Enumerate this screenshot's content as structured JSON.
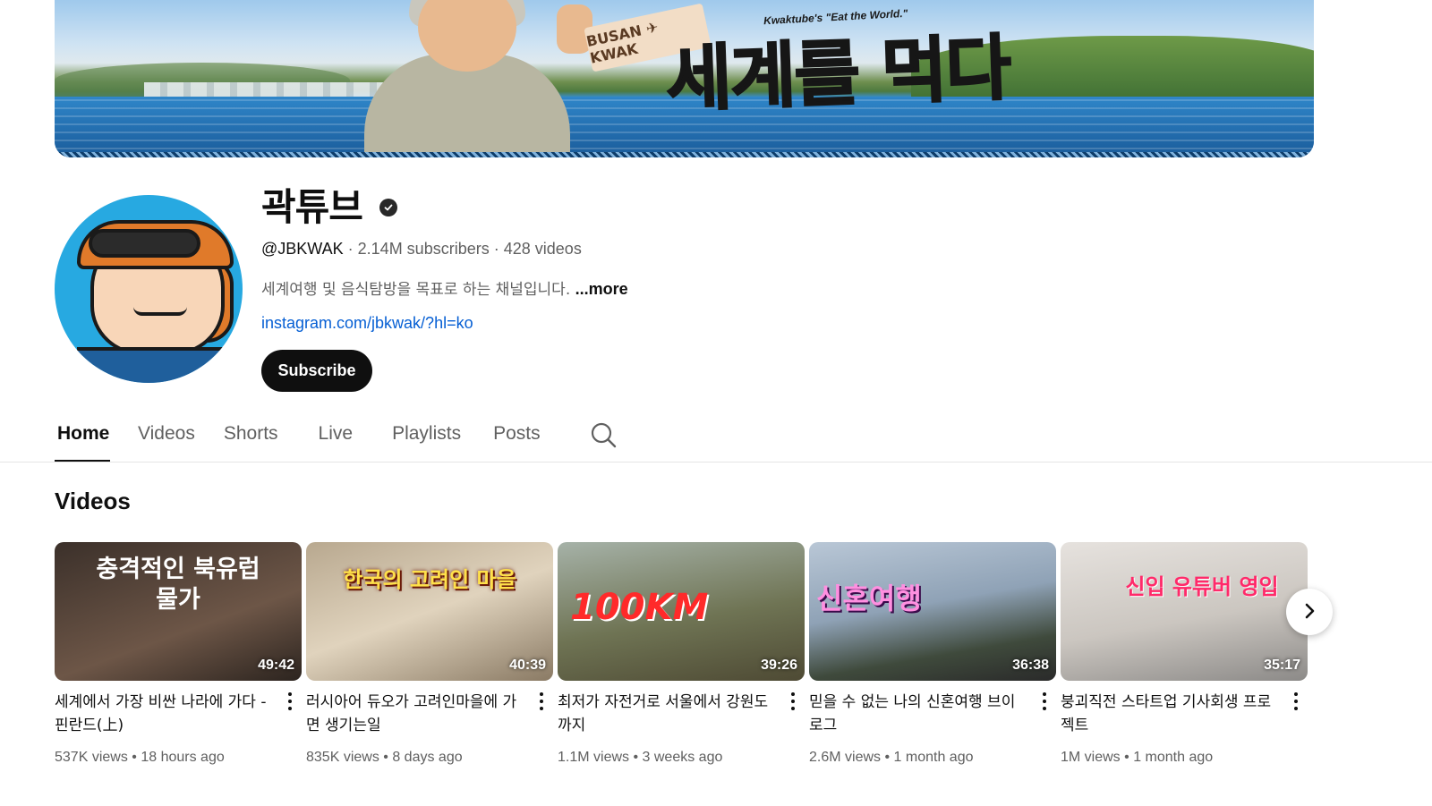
{
  "banner": {
    "tag_text": "BUSAN ✈ KWAK",
    "tagline": "Kwaktube's \"Eat the World.\"",
    "headline": "세계를 먹다"
  },
  "channel": {
    "name": "곽튜브",
    "handle": "@JBKWAK",
    "subscribers": "2.14M subscribers",
    "videos_count": "428 videos",
    "separator": "·",
    "description": "세계여행 및 음식탐방을 목표로 하는 채널입니다.",
    "more_label": "...more",
    "link": "instagram.com/jbkwak/?hl=ko",
    "subscribe_label": "Subscribe"
  },
  "tabs": [
    {
      "label": "Home"
    },
    {
      "label": "Videos"
    },
    {
      "label": "Shorts"
    },
    {
      "label": "Live"
    },
    {
      "label": "Playlists"
    },
    {
      "label": "Posts"
    }
  ],
  "section": {
    "title": "Videos"
  },
  "videos": [
    {
      "thumb_text": "충격적인 북유럽 물가",
      "duration": "49:42",
      "title": "세계에서 가장 비싼 나라에 가다 - 핀란드(上)",
      "views": "537K views",
      "age": "18 hours ago",
      "color": "#5a4638",
      "text_color": "#ffffff"
    },
    {
      "thumb_text": "한국의 고려인 마을",
      "duration": "40:39",
      "title": "러시아어 듀오가 고려인마을에 가면 생기는일",
      "views": "835K views",
      "age": "8 days ago",
      "color": "#c9b9a1",
      "text_color": "#ffe14a"
    },
    {
      "thumb_text": "100KM",
      "duration": "39:26",
      "title": "최저가 자전거로 서울에서 강원도까지",
      "views": "1.1M views",
      "age": "3 weeks ago",
      "color": "#8a8c70",
      "text_color": "#ff2a2a"
    },
    {
      "thumb_text": "신혼여행",
      "duration": "36:38",
      "title": "믿을 수 없는 나의 신혼여행 브이로그",
      "views": "2.6M views",
      "age": "1 month ago",
      "color": "#9fb0c2",
      "text_color": "#ff8fe0"
    },
    {
      "thumb_text": "신입 유튜버 영입",
      "duration": "35:17",
      "title": "붕괴직전 스타트업 기사회생 프로젝트",
      "views": "1M views",
      "age": "1 month ago",
      "color": "#d8d4d0",
      "text_color": "#ff2a6a"
    }
  ],
  "icons": {
    "verified": "verified-check-icon",
    "search": "search-icon",
    "next": "chevron-right-icon",
    "more": "more-vert-icon"
  }
}
